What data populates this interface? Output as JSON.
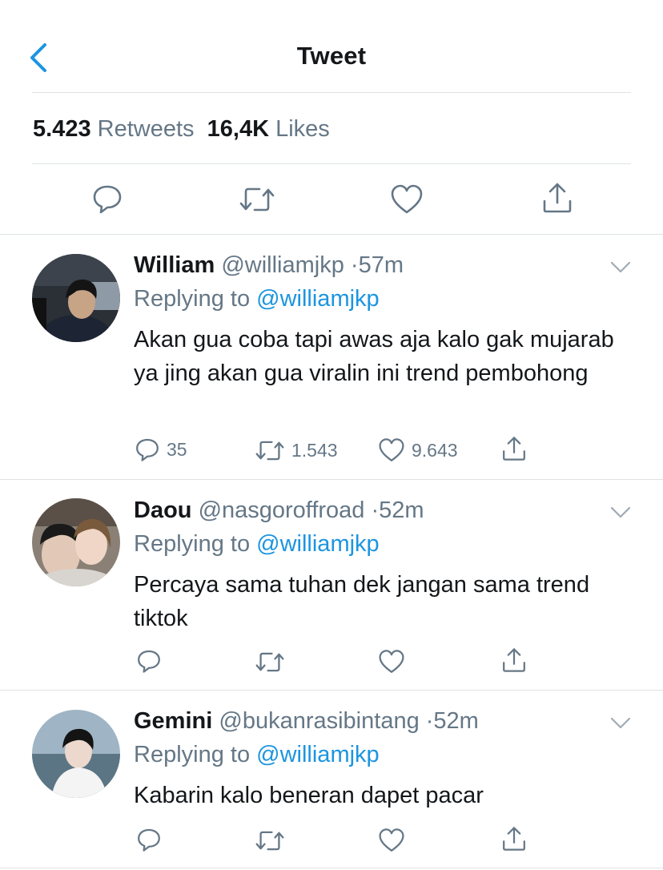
{
  "header": {
    "title": "Tweet"
  },
  "stats": {
    "retweets_count": "5.423",
    "retweets_label": "Retweets",
    "likes_count": "16,4K",
    "likes_label": "Likes"
  },
  "replies": [
    {
      "name": "William",
      "handle": "@williamjkp",
      "time": "·57m",
      "replying_label": "Replying to",
      "replying_to": "@williamjkp",
      "text": "Akan gua coba tapi awas aja kalo gak mujarab ya jing akan gua viralin ini trend pembohong",
      "reply_count": "35",
      "retweet_count": "1.543",
      "like_count": "9.643"
    },
    {
      "name": "Daou",
      "handle": "@nasgoroffroad",
      "time": "·52m",
      "replying_label": "Replying to",
      "replying_to": "@williamjkp",
      "text": "Percaya sama tuhan dek jangan sama trend tiktok"
    },
    {
      "name": "Gemini",
      "handle": "@bukanrasibintang",
      "time": "·52m",
      "replying_label": "Replying to",
      "replying_to": "@williamjkp",
      "text": "Kabarin kalo beneran dapet pacar"
    }
  ],
  "colors": {
    "accent": "#1b95e0",
    "secondary_text": "#657786",
    "divider": "#dfe3e6"
  },
  "icons": [
    "back-chevron-icon",
    "reply-icon",
    "retweet-icon",
    "like-icon",
    "share-icon",
    "caret-down-icon"
  ]
}
